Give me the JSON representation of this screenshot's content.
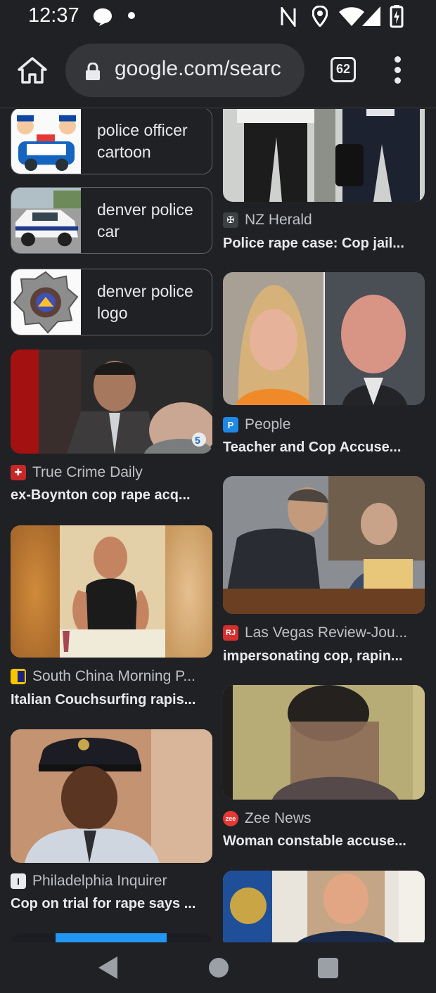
{
  "status": {
    "time": "12:37",
    "icons": [
      "chat-notification-icon",
      "dot-icon",
      "nfc-icon",
      "location-icon",
      "wifi-icon",
      "cell-signal-icon",
      "battery-charging-icon"
    ]
  },
  "browser": {
    "url": "google.com/searc",
    "tab_count": "62",
    "icons": [
      "home-icon",
      "lock-icon",
      "tabs-icon",
      "more-vert-icon"
    ]
  },
  "related_searches": [
    {
      "label": "police officer cartoon"
    },
    {
      "label": "denver police car"
    },
    {
      "label": "denver police logo"
    }
  ],
  "left_results": [
    {
      "source": "True Crime Daily",
      "title": "ex-Boynton cop rape acq...",
      "favicon_color": "#c62828"
    },
    {
      "source": "South China Morning P...",
      "title": "Italian Couchsurfing rapis...",
      "favicon_color": "#f9c400"
    },
    {
      "source": "Philadelphia Inquirer",
      "title": "Cop on trial for rape says ...",
      "favicon_color": "#e8eaed"
    }
  ],
  "right_results": [
    {
      "source": "NZ Herald",
      "title": "Police rape case: Cop jail...",
      "favicon_color": "#3c4043"
    },
    {
      "source": "People",
      "title": "Teacher and Cop Accuse...",
      "favicon_color": "#1e88e5",
      "favicon_letter": "P"
    },
    {
      "source": "Las Vegas Review-Jou...",
      "title": "impersonating cop, rapin...",
      "favicon_color": "#d32f2f",
      "favicon_letter": "RJ"
    },
    {
      "source": "Zee News",
      "title": "Woman constable accuse...",
      "favicon_color": "#e53935",
      "favicon_letter": "zee"
    }
  ],
  "navbar": {
    "icons": [
      "back-icon",
      "home-circle-icon",
      "recents-icon"
    ]
  }
}
